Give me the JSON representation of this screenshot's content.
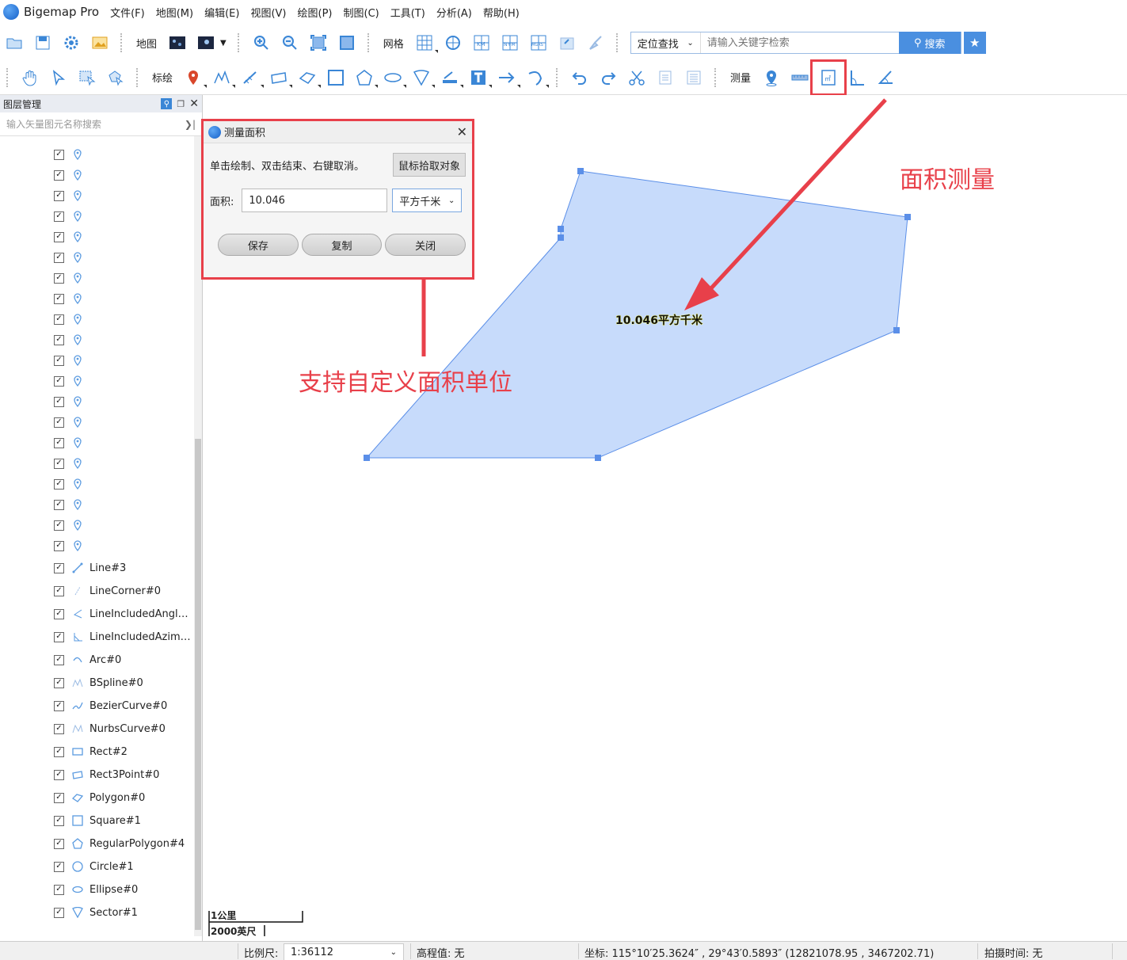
{
  "app": {
    "title": "Bigemap Pro"
  },
  "menu": [
    "文件(F)",
    "地图(M)",
    "编辑(E)",
    "视图(V)",
    "绘图(P)",
    "制图(C)",
    "工具(T)",
    "分析(A)",
    "帮助(H)"
  ],
  "toolbar1": {
    "map_label": "地图",
    "grid_label": "网格",
    "search_mode": "定位查找",
    "search_placeholder": "请输入关键字检索",
    "search_button": "搜索"
  },
  "toolbar2": {
    "draw_label": "标绘",
    "measure_label": "测量",
    "area_icon_text": "㎡"
  },
  "panel": {
    "title": "图层管理",
    "search_placeholder": "输入矢量图元名称搜索"
  },
  "layers": {
    "point_count": 20,
    "named": [
      {
        "name": "Line#3",
        "icon": "line-icon"
      },
      {
        "name": "LineCorner#0",
        "icon": "line-corner-icon"
      },
      {
        "name": "LineIncludedAngle...",
        "icon": "included-angle-icon"
      },
      {
        "name": "LineIncludedAzimu...",
        "icon": "azimuth-icon"
      },
      {
        "name": "Arc#0",
        "icon": "arc-icon"
      },
      {
        "name": "BSpline#0",
        "icon": "bspline-icon"
      },
      {
        "name": "BezierCurve#0",
        "icon": "bezier-icon"
      },
      {
        "name": "NurbsCurve#0",
        "icon": "nurbs-icon"
      },
      {
        "name": "Rect#2",
        "icon": "rect-icon"
      },
      {
        "name": "Rect3Point#0",
        "icon": "rect3point-icon"
      },
      {
        "name": "Polygon#0",
        "icon": "polygon-icon"
      },
      {
        "name": "Square#1",
        "icon": "square-icon"
      },
      {
        "name": "RegularPolygon#4",
        "icon": "regular-polygon-icon"
      },
      {
        "name": "Circle#1",
        "icon": "circle-icon"
      },
      {
        "name": "Ellipse#0",
        "icon": "ellipse-icon"
      },
      {
        "name": "Sector#1",
        "icon": "sector-icon"
      }
    ]
  },
  "dialog": {
    "title": "测量面积",
    "hint": "单击绘制、双击结束、右键取消。",
    "pick_button": "鼠标拾取对象",
    "area_label": "面积:",
    "area_value": "10.046",
    "unit": "平方千米",
    "save_button": "保存",
    "copy_button": "复制",
    "close_button": "关闭"
  },
  "map": {
    "area_label": "10.046平方千米",
    "scale_top": "1公里",
    "scale_bottom": "2000英尺",
    "colors": {
      "polygon_fill": "#c7dbfb",
      "polygon_stroke": "#5b8fe8",
      "annotation": "#e8404a"
    }
  },
  "annotations": {
    "area_measure": "面积测量",
    "custom_unit": "支持自定义面积单位"
  },
  "status": {
    "scale_label": "比例尺:",
    "scale_value": "1:36112",
    "elevation": "高程值: 无",
    "coords": "坐标: 115°10′25.3624″ , 29°43′0.5893″   (12821078.95 , 3467202.71)",
    "capture_time": "拍摄时间: 无"
  }
}
